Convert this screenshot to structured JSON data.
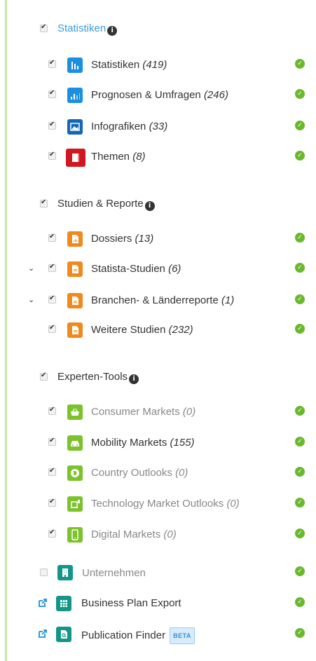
{
  "sections": {
    "statistiken": {
      "title": "Statistiken",
      "items": [
        {
          "label": "Statistiken",
          "count": "(419)"
        },
        {
          "label": "Prognosen & Umfragen",
          "count": "(246)"
        },
        {
          "label": "Infografiken",
          "count": "(33)"
        },
        {
          "label": "Themen",
          "count": "(8)"
        }
      ]
    },
    "studien": {
      "title": "Studien & Reporte",
      "items": [
        {
          "label": "Dossiers",
          "count": "(13)"
        },
        {
          "label": "Statista-Studien",
          "count": "(6)"
        },
        {
          "label": "Branchen- & Länderreporte",
          "count": "(1)"
        },
        {
          "label": "Weitere Studien",
          "count": "(232)"
        }
      ]
    },
    "experten": {
      "title": "Experten-Tools",
      "items": [
        {
          "label": "Consumer Markets",
          "count": "(0)"
        },
        {
          "label": "Mobility Markets",
          "count": "(155)"
        },
        {
          "label": "Country Outlooks",
          "count": "(0)"
        },
        {
          "label": "Technology Market Outlooks",
          "count": "(0)"
        },
        {
          "label": "Digital Markets",
          "count": "(0)"
        }
      ]
    }
  },
  "standalone": {
    "unternehmen": {
      "label": "Unternehmen"
    },
    "business_plan": {
      "label": "Business Plan Export"
    },
    "publication_finder": {
      "label": "Publication Finder",
      "badge": "BETA"
    }
  },
  "colors": {
    "blue": "#1b8fe0",
    "dark_blue": "#1466b8",
    "red": "#d01820",
    "orange": "#f08a1e",
    "green": "#7cc22a",
    "teal": "#14958a",
    "status_green": "#6ab82e"
  }
}
